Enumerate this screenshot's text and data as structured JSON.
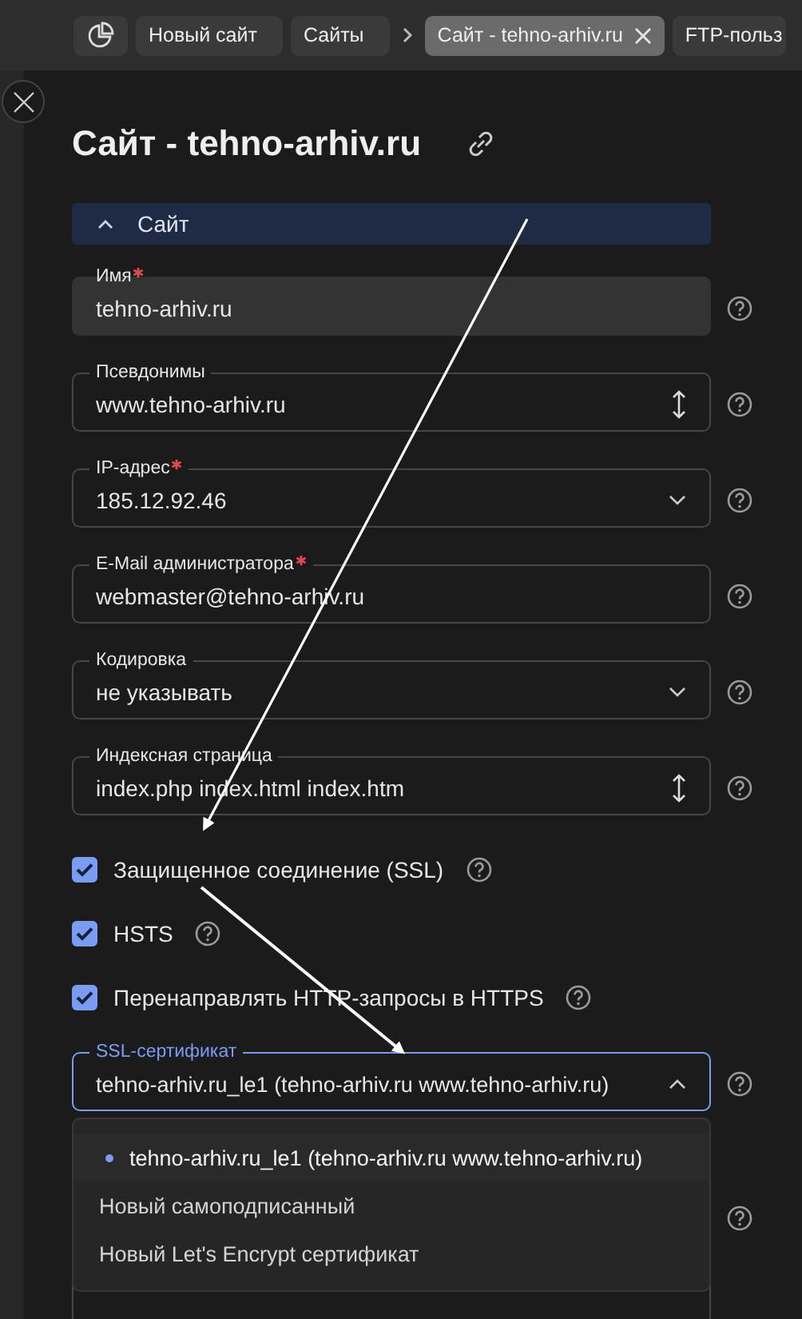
{
  "breadcrumbs": [
    {
      "kind": "icon",
      "selected": false
    },
    {
      "kind": "tab",
      "label": "Новый сайт",
      "selected": false,
      "closable": false
    },
    {
      "kind": "tab",
      "label": "Сайты",
      "selected": false,
      "closable": false
    },
    {
      "kind": "separator"
    },
    {
      "kind": "tab",
      "label": "Сайт - tehno-arhiv.ru",
      "selected": true,
      "closable": true
    },
    {
      "kind": "tab",
      "label": "FTP-польз",
      "selected": false,
      "closable": false
    }
  ],
  "title": "Сайт - tehno-arhiv.ru",
  "section": {
    "label": "Сайт",
    "expanded": true
  },
  "fields": [
    {
      "kind": "filled",
      "label": "Имя",
      "required": true,
      "value": "tehno-arhiv.ru"
    },
    {
      "kind": "multi",
      "label": "Псевдонимы",
      "required": false,
      "value": "www.tehno-arhiv.ru"
    },
    {
      "kind": "select",
      "label": "IP-адрес",
      "required": true,
      "value": "185.12.92.46"
    },
    {
      "kind": "text",
      "label": "E-Mail администратора",
      "required": true,
      "value": "webmaster@tehno-arhiv.ru"
    },
    {
      "kind": "select",
      "label": "Кодировка",
      "required": false,
      "value": "не указывать"
    },
    {
      "kind": "multi",
      "label": "Индексная страница",
      "required": false,
      "value": "index.php index.html index.htm"
    }
  ],
  "checkboxes": [
    {
      "label": "Защищенное соединение (SSL)",
      "checked": true
    },
    {
      "label": "HSTS",
      "checked": true
    },
    {
      "label": "Перенаправлять HTTP-запросы в HTTPS",
      "checked": true
    }
  ],
  "ssl": {
    "label": "SSL-сертификат",
    "value": "tehno-arhiv.ru_le1 (tehno-arhiv.ru www.tehno-arhiv.ru)",
    "open": true,
    "options": [
      {
        "label": "tehno-arhiv.ru_le1 (tehno-arhiv.ru www.tehno-arhiv.ru)",
        "selected": true
      },
      {
        "label": "Новый самоподписанный",
        "selected": false
      },
      {
        "label": "Новый Let's Encrypt сертификат",
        "selected": false
      }
    ]
  }
}
